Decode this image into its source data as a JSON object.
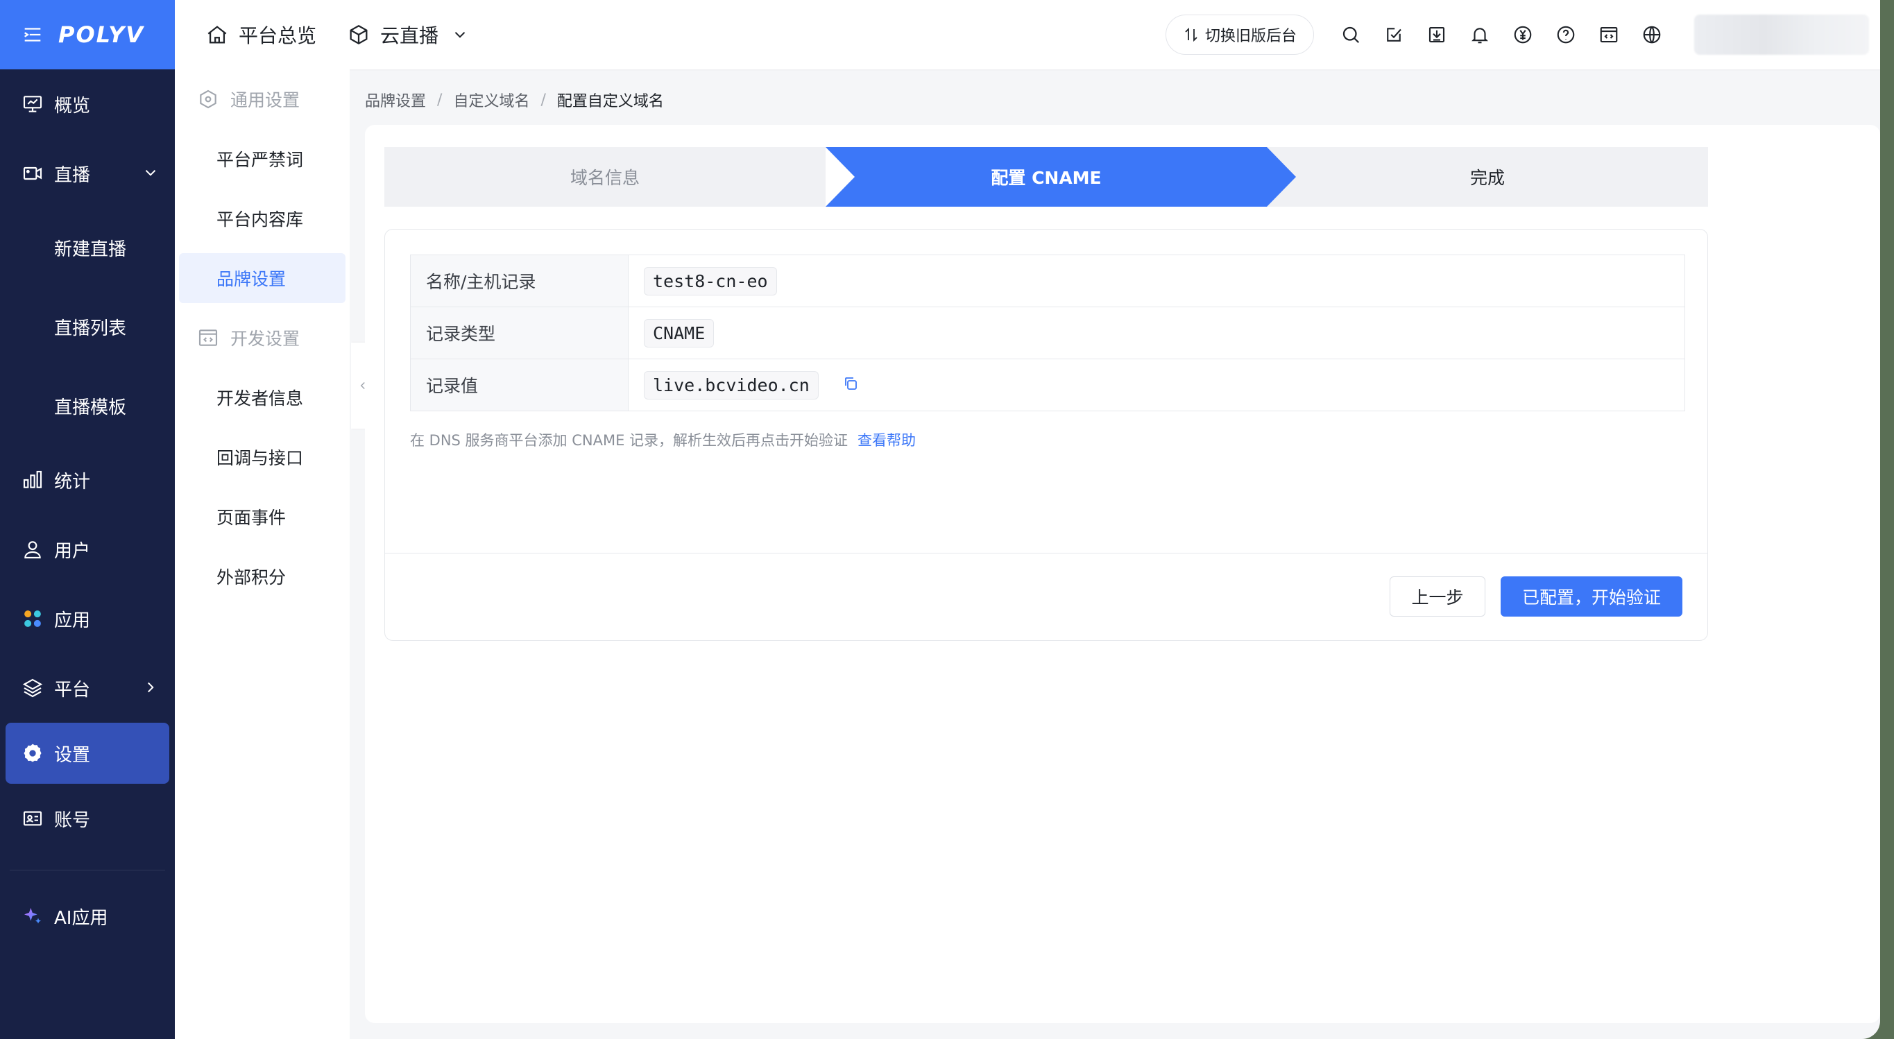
{
  "app": {
    "logo_text": "POLYV",
    "brand_color": "#3c77f8",
    "sidebar_bg": "#182145"
  },
  "sidebar": {
    "items": [
      {
        "label": "概览",
        "icon": "monitor-chart-icon"
      },
      {
        "label": "直播",
        "icon": "video-camera-icon",
        "expanded": true
      },
      {
        "label": "新建直播"
      },
      {
        "label": "直播列表"
      },
      {
        "label": "直播模板"
      },
      {
        "label": "统计",
        "icon": "bar-chart-icon"
      },
      {
        "label": "用户",
        "icon": "user-icon"
      },
      {
        "label": "应用",
        "icon": "apps-icon"
      },
      {
        "label": "平台",
        "icon": "layers-icon"
      },
      {
        "label": "设置",
        "icon": "gear-icon",
        "active": true
      },
      {
        "label": "账号",
        "icon": "id-card-icon"
      },
      {
        "label": "AI应用",
        "icon": "sparkle-icon"
      }
    ]
  },
  "header": {
    "overview_label": "平台总览",
    "product_label": "云直播",
    "switch_label": "切换旧版后台",
    "icons": [
      "search-icon",
      "task-icon",
      "download-icon",
      "bell-icon",
      "yen-icon",
      "help-icon",
      "code-icon",
      "globe-icon"
    ]
  },
  "subnav": {
    "group1": "通用设置",
    "items1": [
      "平台严禁词",
      "平台内容库",
      "品牌设置"
    ],
    "active": "品牌设置",
    "group2": "开发设置",
    "items2": [
      "开发者信息",
      "回调与接口",
      "页面事件",
      "外部积分"
    ]
  },
  "breadcrumb": [
    "品牌设置",
    "自定义域名",
    "配置自定义域名"
  ],
  "steps": [
    "域名信息",
    "配置 CNAME",
    "完成"
  ],
  "current_step": 2,
  "records": [
    {
      "label": "名称/主机记录",
      "value": "test8-cn-eo"
    },
    {
      "label": "记录类型",
      "value": "CNAME"
    },
    {
      "label": "记录值",
      "value": "live.bcvideo.cn"
    }
  ],
  "hint": "在 DNS 服务商平台添加 CNAME 记录，解析生效后再点击开始验证",
  "hint_link": "查看帮助",
  "buttons": {
    "prev": "上一步",
    "verify": "已配置，开始验证"
  }
}
